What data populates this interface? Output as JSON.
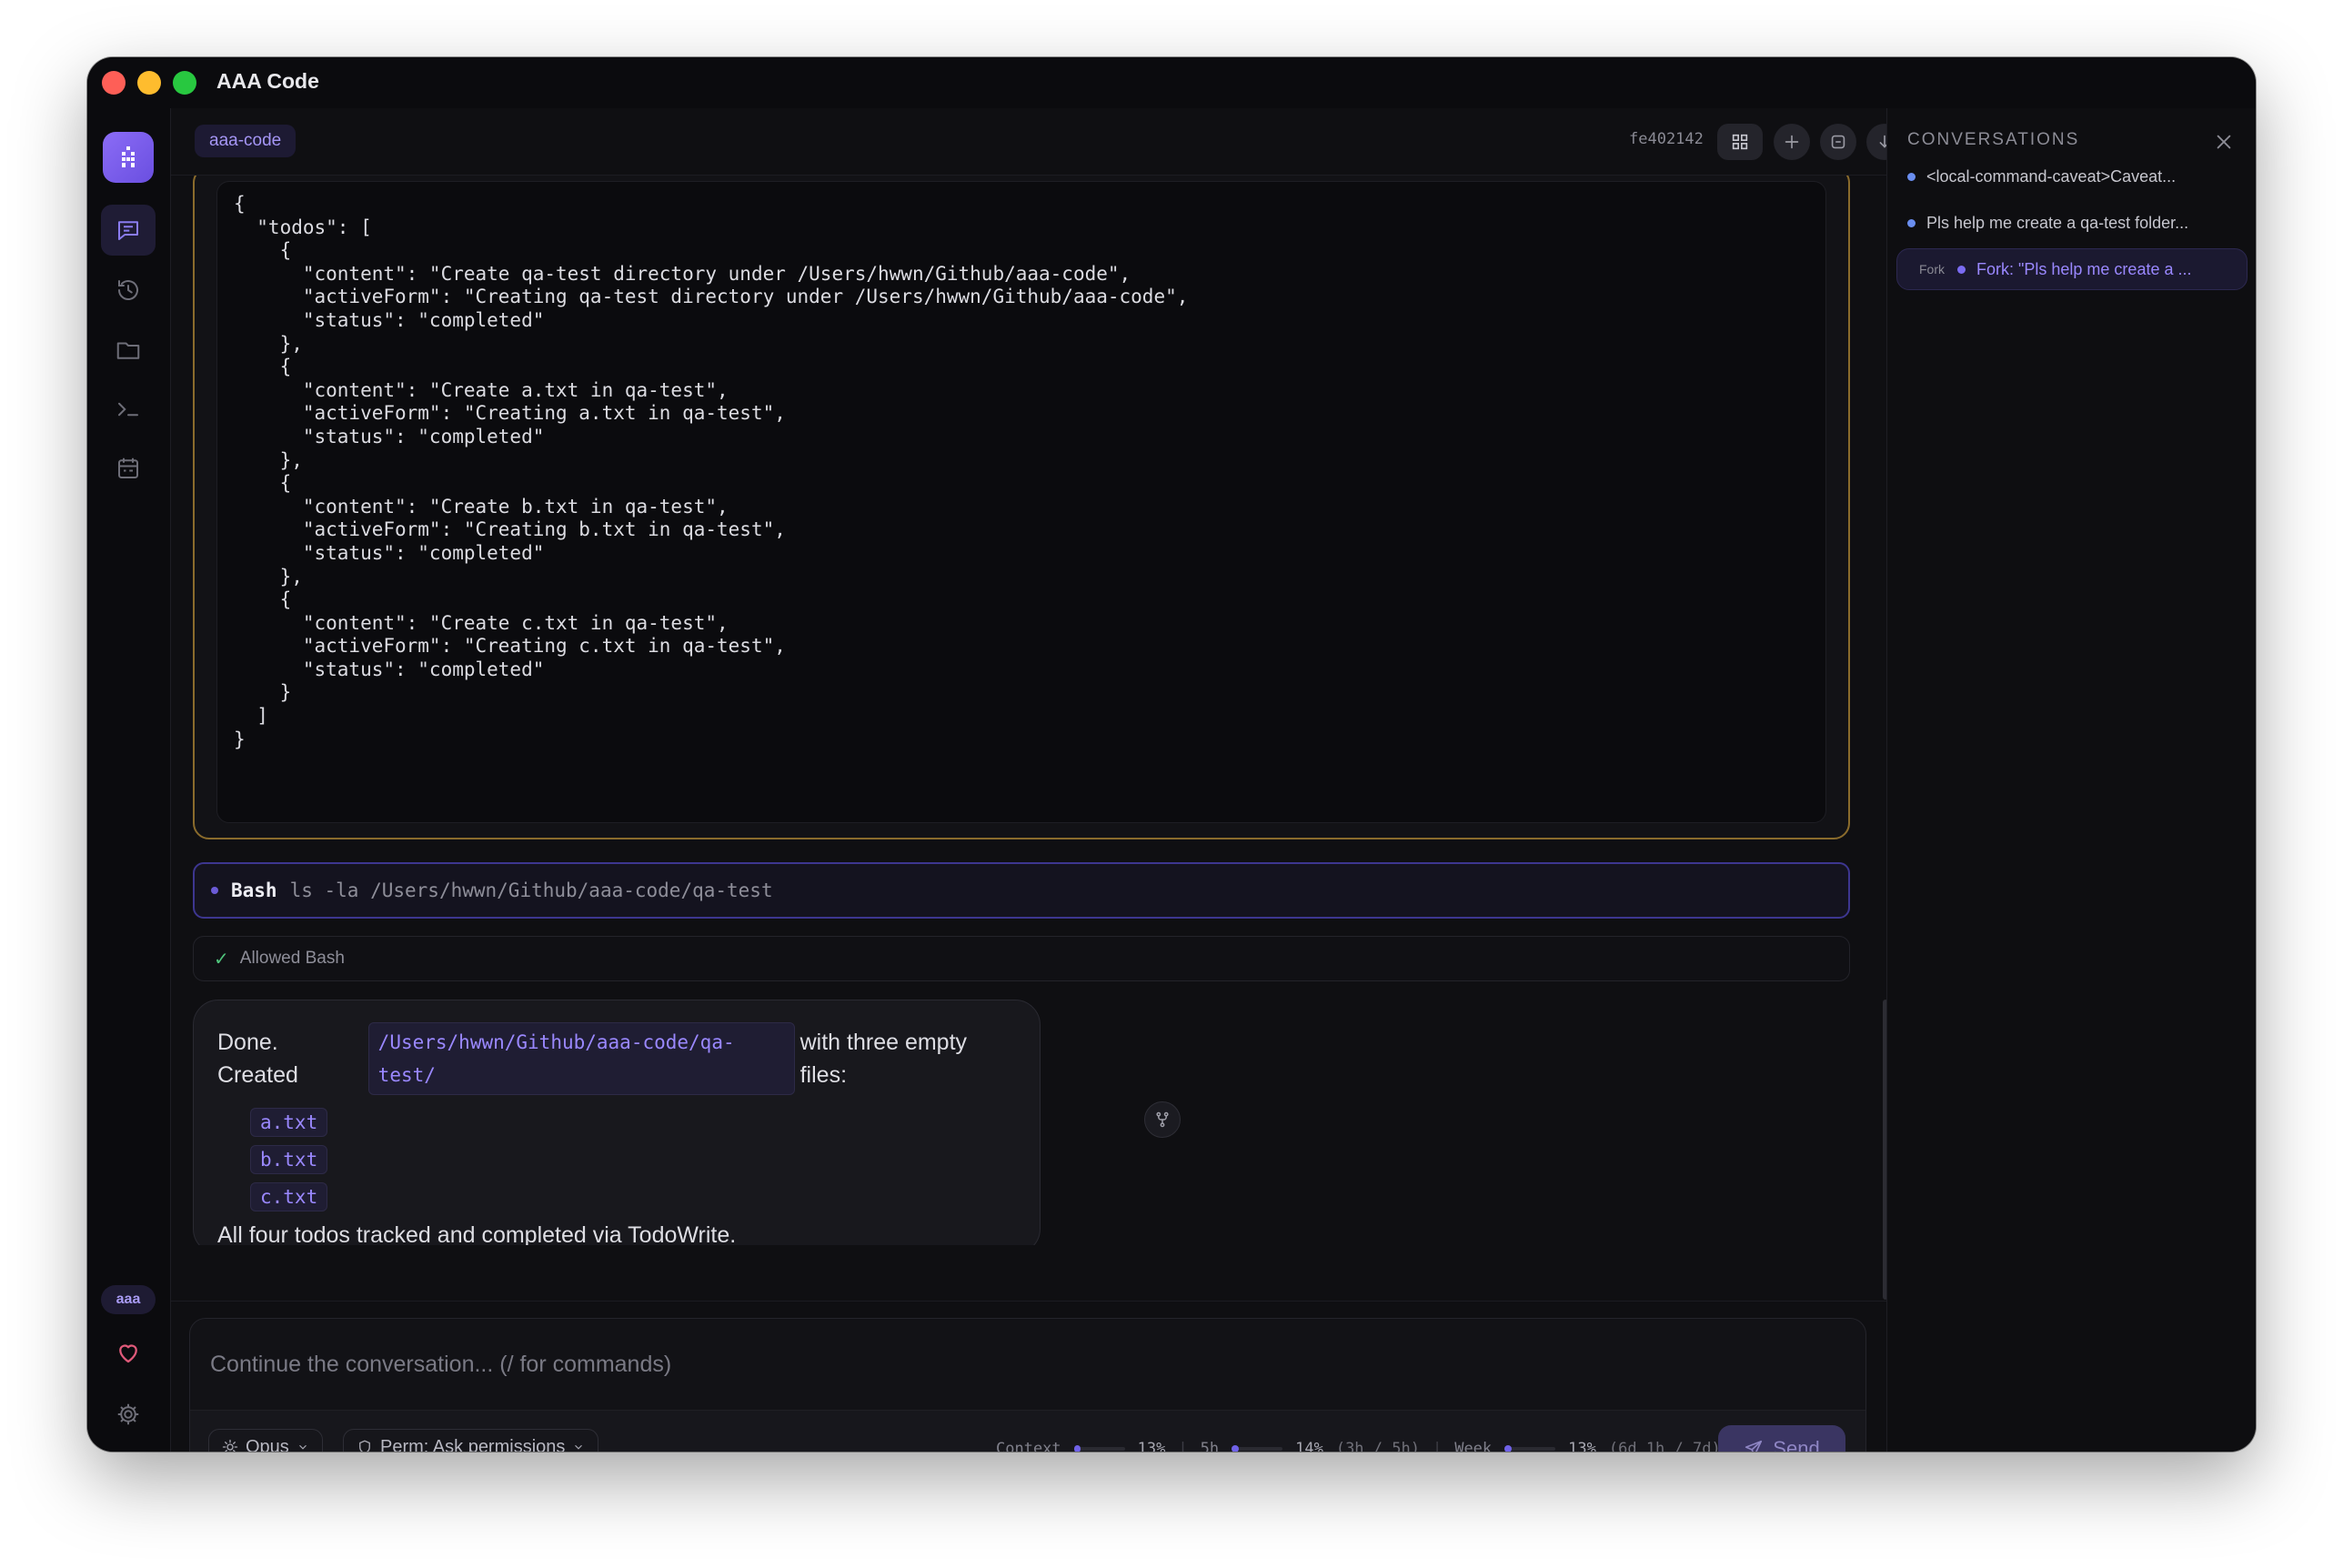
{
  "window": {
    "title": "AAA Code"
  },
  "header": {
    "repo": "aaa-code",
    "commit": "fe402142"
  },
  "rail": {
    "badge": "aaa",
    "items": [
      "chat",
      "history",
      "files",
      "terminal",
      "calendar"
    ]
  },
  "json_block": "{\n  \"todos\": [\n    {\n      \"content\": \"Create qa-test directory under /Users/hwwn/Github/aaa-code\",\n      \"activeForm\": \"Creating qa-test directory under /Users/hwwn/Github/aaa-code\",\n      \"status\": \"completed\"\n    },\n    {\n      \"content\": \"Create a.txt in qa-test\",\n      \"activeForm\": \"Creating a.txt in qa-test\",\n      \"status\": \"completed\"\n    },\n    {\n      \"content\": \"Create b.txt in qa-test\",\n      \"activeForm\": \"Creating b.txt in qa-test\",\n      \"status\": \"completed\"\n    },\n    {\n      \"content\": \"Create c.txt in qa-test\",\n      \"activeForm\": \"Creating c.txt in qa-test\",\n      \"status\": \"completed\"\n    }\n  ]\n}",
  "bash": {
    "tool": "Bash",
    "command": "ls -la /Users/hwwn/Github/aaa-code/qa-test"
  },
  "allowed": {
    "text": "Allowed Bash"
  },
  "reply": {
    "prefix": "Done. Created",
    "path": "/Users/hwwn/Github/aaa-code/qa-test/",
    "suffix": "with three empty files:",
    "files": [
      "a.txt",
      "b.txt",
      "c.txt"
    ],
    "footer": "All four todos tracked and completed via TodoWrite."
  },
  "composer": {
    "placeholder": "Continue the conversation... (/ for commands)",
    "model": "Opus",
    "permission": "Perm: Ask permissions",
    "send": "Send",
    "stats": {
      "context_label": "Context",
      "context_value": "13%",
      "context_fraction": 0.13,
      "fivehour_label": "5h",
      "fivehour_value": "14%",
      "fivehour_detail": "(3h / 5h)",
      "fivehour_fraction": 0.14,
      "week_label": "Week",
      "week_value": "13%",
      "week_detail": "(6d 1h / 7d)",
      "week_fraction": 0.13
    }
  },
  "conversations": {
    "title": "CONVERSATIONS",
    "items": [
      {
        "label": "<local-command-caveat>Caveat..."
      },
      {
        "label": "Pls help me create a qa-test folder..."
      },
      {
        "tag": "Fork",
        "label": "Fork: \"Pls help me create a ..."
      }
    ]
  },
  "colors": {
    "accent": "#7b6cf2",
    "json_border": "#8a6b2c",
    "bash_border": "#3d3690",
    "check": "#4fc47c"
  }
}
